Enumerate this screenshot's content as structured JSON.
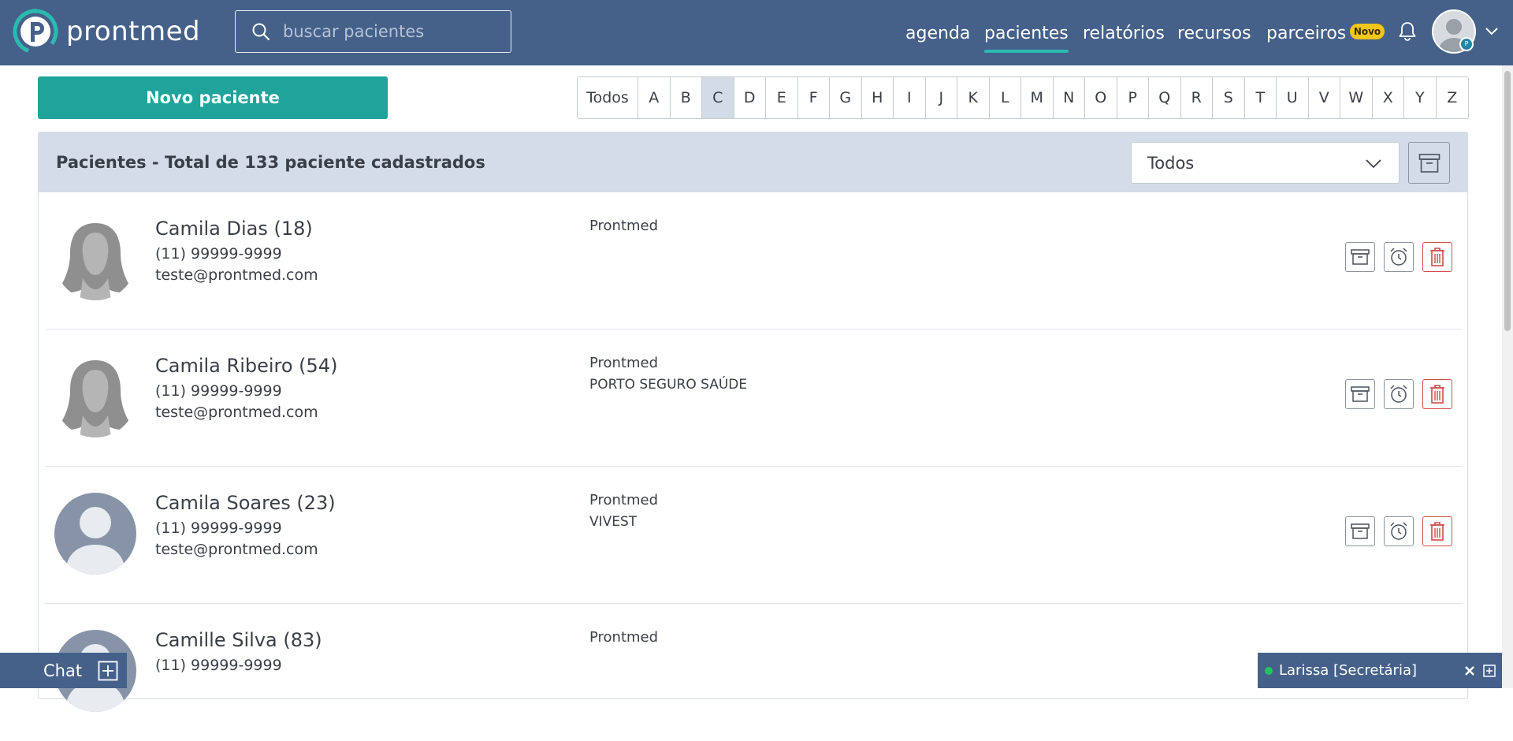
{
  "header": {
    "brand": "prontmed",
    "search_placeholder": "buscar pacientes",
    "nav": [
      {
        "label": "agenda"
      },
      {
        "label": "pacientes"
      },
      {
        "label": "relatórios"
      },
      {
        "label": "recursos"
      },
      {
        "label": "parceiros"
      }
    ],
    "parceiros_badge": "Novo",
    "user_badge": "P"
  },
  "toolbar": {
    "new_patient_label": "Novo paciente",
    "alphabet": [
      "Todos",
      "A",
      "B",
      "C",
      "D",
      "E",
      "F",
      "G",
      "H",
      "I",
      "J",
      "K",
      "L",
      "M",
      "N",
      "O",
      "P",
      "Q",
      "R",
      "S",
      "T",
      "U",
      "V",
      "W",
      "X",
      "Y",
      "Z"
    ],
    "selected_letter": "C"
  },
  "panel": {
    "title": "Pacientes - Total de 133 paciente cadastrados",
    "filter_value": "Todos"
  },
  "patients": [
    {
      "name": "Camila Dias (18)",
      "phone": "(11) 99999-9999",
      "email": "teste@prontmed.com",
      "clinic": "Prontmed",
      "plan": "",
      "avatar": "female-silhouette"
    },
    {
      "name": "Camila Ribeiro (54)",
      "phone": "(11) 99999-9999",
      "email": "teste@prontmed.com",
      "clinic": "Prontmed",
      "plan": "PORTO SEGURO SAÚDE",
      "avatar": "female-silhouette"
    },
    {
      "name": "Camila Soares (23)",
      "phone": "(11) 99999-9999",
      "email": "teste@prontmed.com",
      "clinic": "Prontmed",
      "plan": "VIVEST",
      "avatar": "generic-person"
    },
    {
      "name": "Camille Silva (83)",
      "phone": "(11) 99999-9999",
      "email": "",
      "clinic": "Prontmed",
      "plan": "",
      "avatar": "generic-person"
    }
  ],
  "chat": {
    "label": "Chat",
    "contact": "Larissa [Secretária]"
  },
  "colors": {
    "header_bg": "#45618a",
    "primary_button": "#1fa39a",
    "active_underline": "#2bbab0",
    "delete_red": "#d14b4b",
    "novo_badge": "#f5c518"
  }
}
